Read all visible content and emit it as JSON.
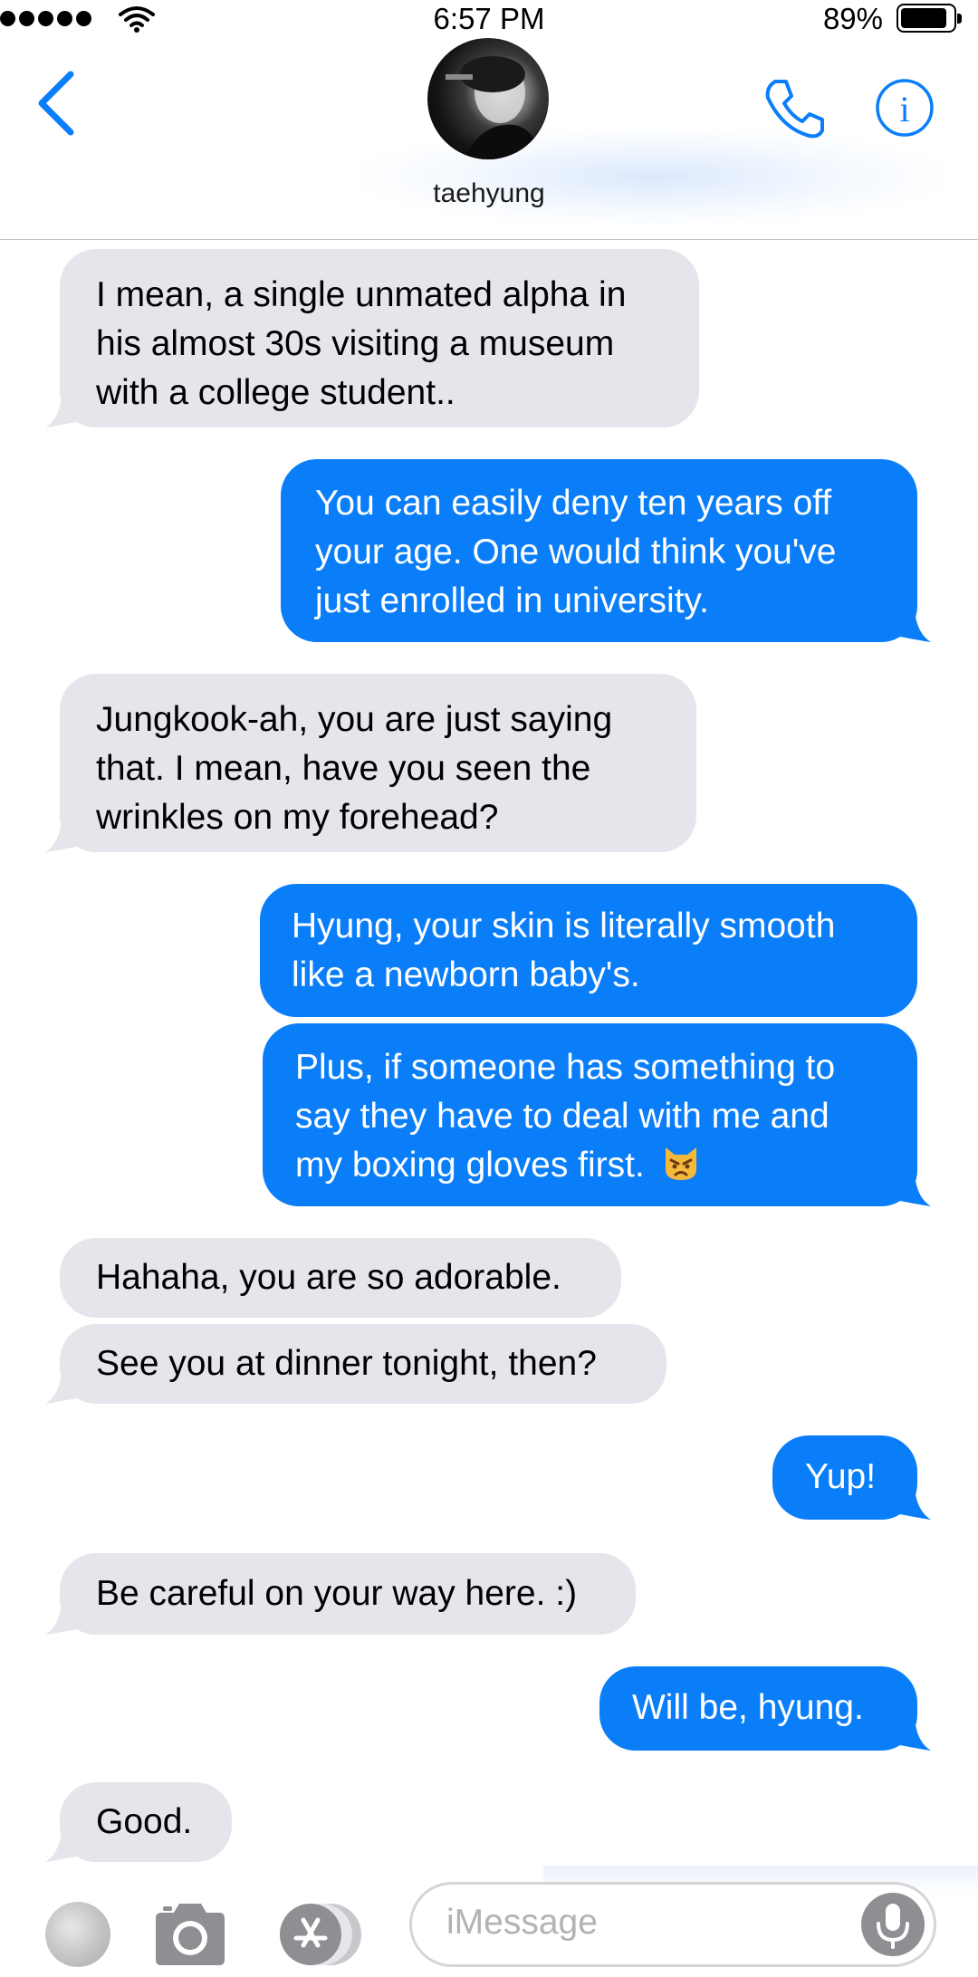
{
  "status_bar": {
    "time": "6:57 PM",
    "battery_percent": "89%",
    "battery_level": 0.89,
    "signal_bars": 5
  },
  "header": {
    "contact_name": "taehyung",
    "accent_color": "#0a7ef9"
  },
  "messages": [
    {
      "direction": "incoming",
      "text": "I mean, a single unmated alpha in his almost 30s visiting a museum with a college student..",
      "lines": [
        "I mean, a single unmated alpha in",
        "his almost 30s visiting a museum",
        "with a college student.."
      ]
    },
    {
      "direction": "outgoing",
      "text": "You can easily deny ten years off your age. One would think you've just enrolled in university.",
      "lines": [
        "You can easily deny ten years off",
        "your age. One would think you've",
        "just enrolled in university."
      ]
    },
    {
      "direction": "incoming",
      "text": "Jungkook-ah, you are just saying that. I mean, have you seen the wrinkles on my forehead?",
      "lines": [
        "Jungkook-ah, you are just saying",
        "that. I mean, have you seen the",
        "wrinkles on my forehead?"
      ]
    },
    {
      "direction": "outgoing",
      "text": "Hyung, your skin is literally smooth like a newborn baby's.",
      "lines": [
        "Hyung, your skin is literally smooth",
        "like a newborn baby's."
      ]
    },
    {
      "direction": "outgoing",
      "text": "Plus, if someone has something to say they have to deal with me and my boxing gloves first.",
      "lines": [
        "Plus, if someone has something to",
        "say they have to deal with me and",
        "my boxing gloves first."
      ],
      "emoji": "pouting-cat-emoji"
    },
    {
      "direction": "incoming",
      "text": "Hahaha, you are so adorable.",
      "lines": [
        "Hahaha, you are so adorable."
      ]
    },
    {
      "direction": "incoming",
      "text": "See you at dinner tonight, then?",
      "lines": [
        "See you at dinner tonight, then?"
      ]
    },
    {
      "direction": "outgoing",
      "text": "Yup!",
      "lines": [
        "Yup!"
      ]
    },
    {
      "direction": "incoming",
      "text": "Be careful on your way here. :)",
      "lines": [
        "Be careful on your way here. :)"
      ]
    },
    {
      "direction": "outgoing",
      "text": "Will be, hyung.",
      "lines": [
        "Will be, hyung."
      ]
    },
    {
      "direction": "incoming",
      "text": "Good.",
      "lines": [
        "Good."
      ]
    }
  ],
  "input_bar": {
    "placeholder": "iMessage"
  },
  "colors": {
    "incoming_bubble": "#e6e5eb",
    "outgoing_bubble": "#0a7ef9",
    "icon_gray": "#8e8e93"
  },
  "icons": {
    "back": "chevron-left-icon",
    "call": "phone-icon",
    "info": "info-icon",
    "camera": "camera-icon",
    "apps": "app-store-icon",
    "mic": "microphone-icon"
  }
}
